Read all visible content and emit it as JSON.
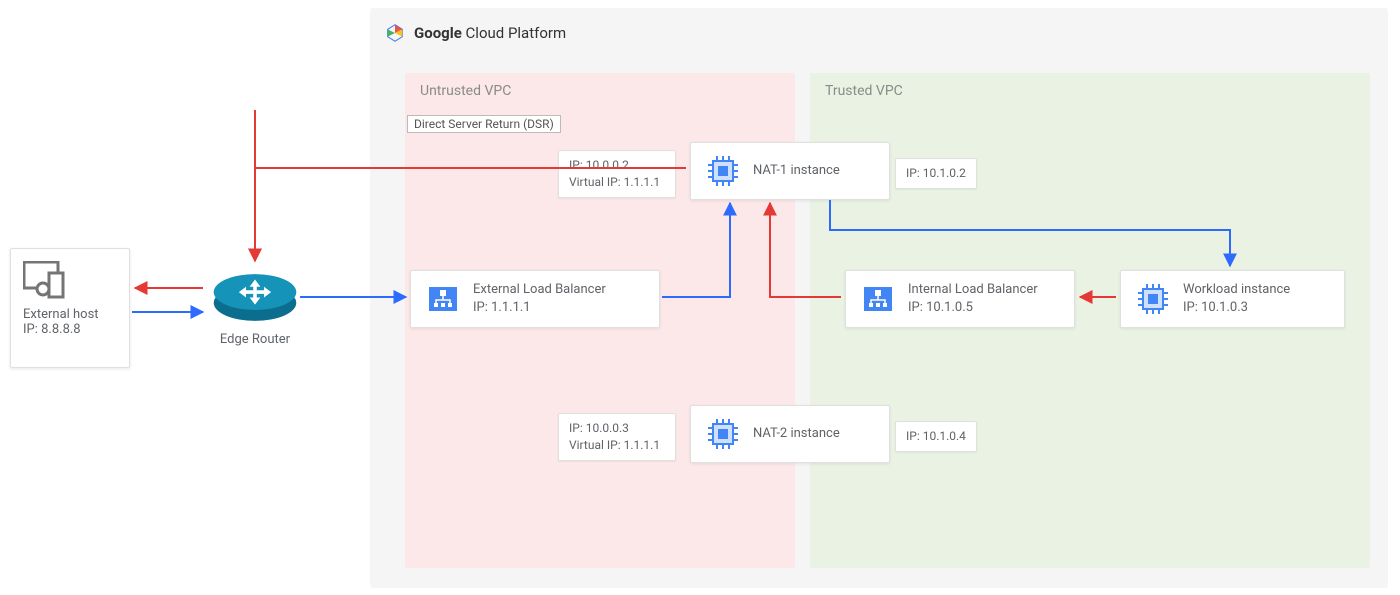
{
  "header": {
    "brand_bold": "Google",
    "brand_rest": " Cloud Platform"
  },
  "vpc": {
    "untrusted_label": "Untrusted VPC",
    "trusted_label": "Trusted VPC"
  },
  "external_host": {
    "label": "External host",
    "ip_line": "IP: 8.8.8.8"
  },
  "router": {
    "label": "Edge Router"
  },
  "lb_ext": {
    "title": "External Load Balancer",
    "ip_line": "IP: 1.1.1.1"
  },
  "lb_int": {
    "title": "Internal Load Balancer",
    "ip_line": "IP: 10.1.0.5"
  },
  "nat1": {
    "title": "NAT-1 instance",
    "left_ip1": "IP: 10.0.0.2",
    "left_ip2": "Virtual IP: 1.1.1.1",
    "right_ip": "IP: 10.1.0.2"
  },
  "nat2": {
    "title": "NAT-2 instance",
    "left_ip1": "IP: 10.0.0.3",
    "left_ip2": "Virtual IP: 1.1.1.1",
    "right_ip": "IP: 10.1.0.4"
  },
  "workload": {
    "title": "Workload instance",
    "ip_line": "IP: 10.1.0.3"
  },
  "dsr": {
    "label": "Direct Server Return (DSR)"
  },
  "colors": {
    "blue": "#2d6bff",
    "red": "#e53935"
  }
}
